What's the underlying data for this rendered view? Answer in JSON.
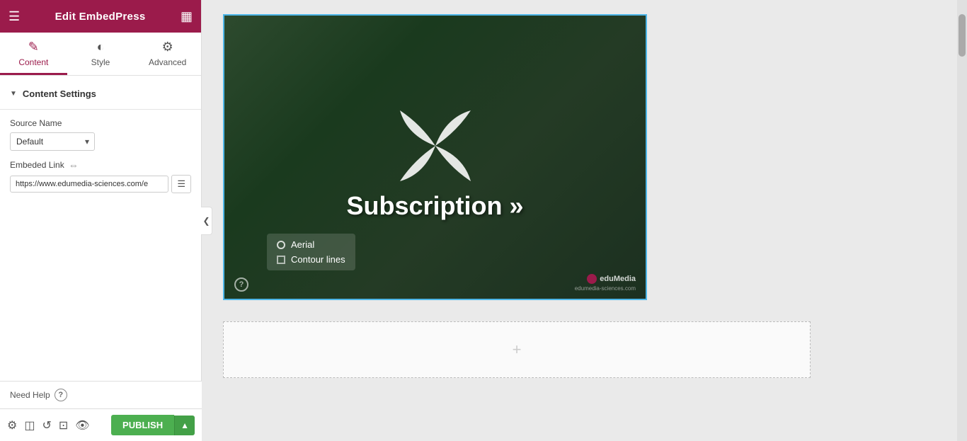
{
  "header": {
    "title": "Edit EmbedPress",
    "menu_icon": "≡",
    "grid_icon": "⊞"
  },
  "tabs": [
    {
      "id": "content",
      "label": "Content",
      "icon": "✎",
      "active": true
    },
    {
      "id": "style",
      "label": "Style",
      "icon": "◐",
      "active": false
    },
    {
      "id": "advanced",
      "label": "Advanced",
      "icon": "⚙",
      "active": false
    }
  ],
  "content_section": {
    "title": "Content Settings",
    "source_name_label": "Source Name",
    "source_name_value": "Default",
    "source_name_options": [
      "Default"
    ],
    "embed_link_label": "Embeded Link",
    "embed_link_value": "https://www.edumedia-sciences.com/e",
    "embed_link_placeholder": "https://www.edumedia-sciences.com/e"
  },
  "footer": {
    "need_help_label": "Need Help"
  },
  "toolbar": {
    "settings_icon": "⚙",
    "layers_icon": "◫",
    "undo_icon": "↺",
    "responsive_icon": "⊡",
    "eye_icon": "👁",
    "publish_label": "PUBLISH",
    "publish_arrow": "▲"
  },
  "main": {
    "video": {
      "subscription_text": "Subscription »",
      "overlay_item1": "Aerial",
      "overlay_item2": "Contour lines",
      "branding_name": "eduMedia",
      "branding_sub": "edumedia-sciences.com"
    },
    "empty_block_icon": "+"
  }
}
